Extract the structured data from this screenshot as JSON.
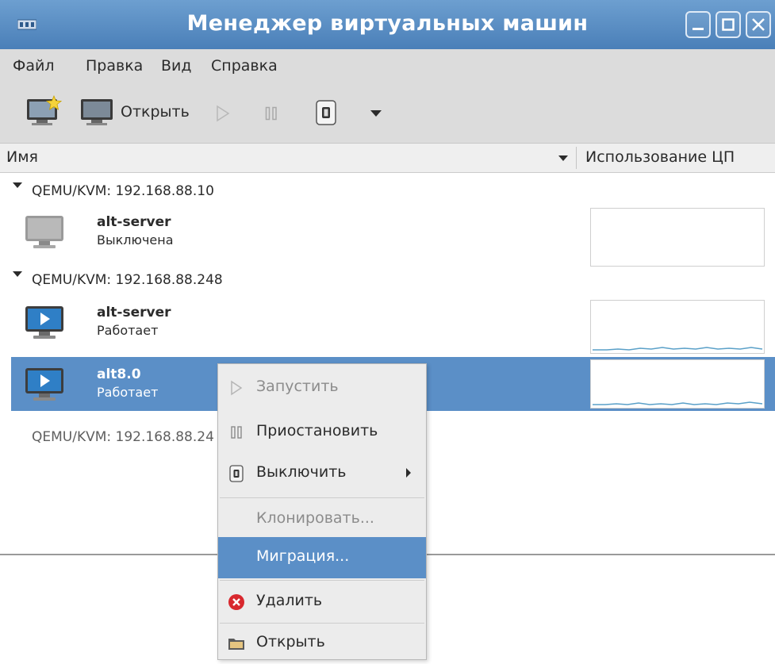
{
  "window": {
    "title": "Менеджер виртуальных машин"
  },
  "menubar": {
    "items": [
      "Файл",
      "Правка",
      "Вид",
      "Справка"
    ]
  },
  "toolbar": {
    "open_label": "Открыть"
  },
  "columns": {
    "name": "Имя",
    "cpu": "Использование ЦП"
  },
  "connections": [
    {
      "label": "QEMU/KVM: 192.168.88.10",
      "vms": [
        {
          "name": "alt-server",
          "status": "Выключена"
        }
      ]
    },
    {
      "label": "QEMU/KVM: 192.168.88.248",
      "vms": [
        {
          "name": "alt-server",
          "status": "Работает"
        },
        {
          "name": "alt8.0",
          "status": "Работает"
        }
      ]
    },
    {
      "label": "QEMU/KVM: 192.168.88.24"
    }
  ],
  "context_menu": {
    "items": [
      {
        "label": "Запустить",
        "enabled": false
      },
      {
        "label": "Приостановить",
        "enabled": true
      },
      {
        "label": "Выключить",
        "enabled": true
      },
      {
        "label": "Клонировать...",
        "enabled": false
      },
      {
        "label": "Миграция...",
        "enabled": true
      },
      {
        "label": "Удалить",
        "enabled": true
      },
      {
        "label": "Открыть",
        "enabled": true
      }
    ]
  },
  "colors": {
    "titlebar": "#4a7fb8",
    "selection": "#5b8fc7",
    "menubar_bg": "#dcdcdc",
    "cpu_line": "#5aa0c8"
  }
}
